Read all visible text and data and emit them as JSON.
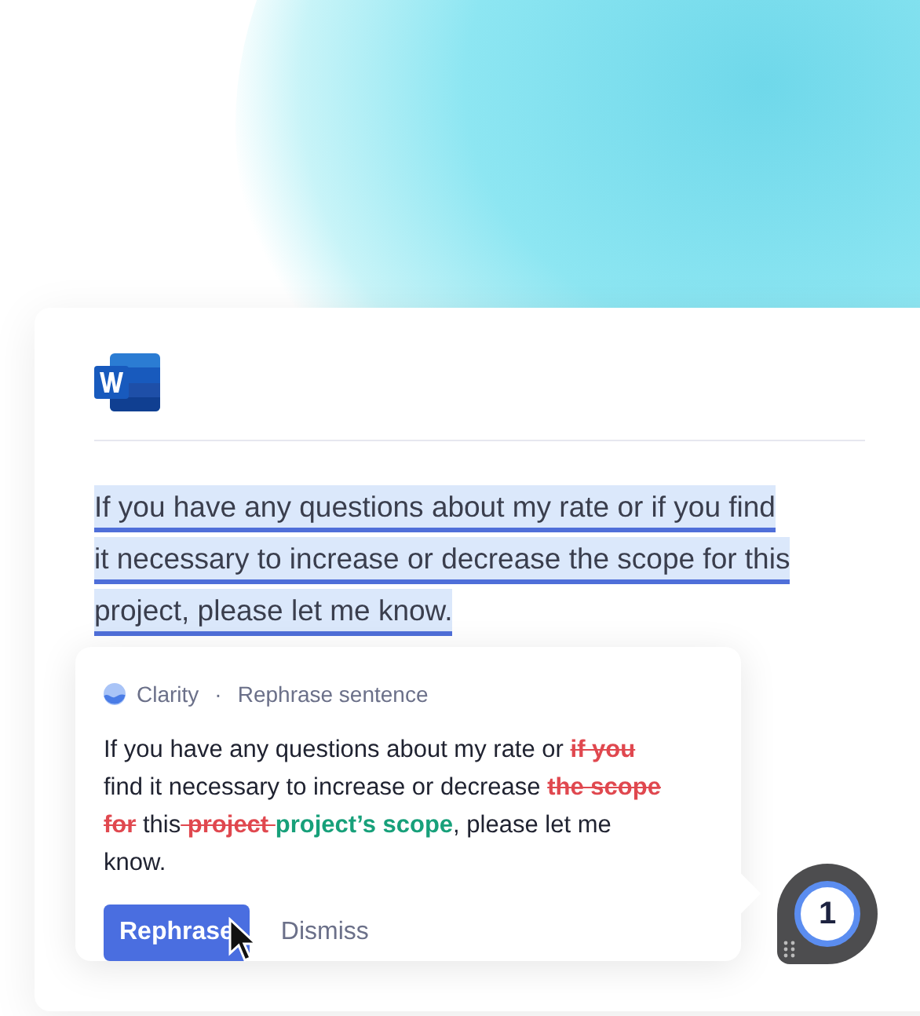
{
  "document": {
    "paragraph_lines": [
      "If you have any questions about my rate or if you find",
      "it necessary to increase or decrease the scope for this",
      "project, please let me know."
    ]
  },
  "suggestion": {
    "category": "Clarity",
    "separator": "·",
    "title": "Rephrase sentence",
    "segments": [
      {
        "kind": "plain",
        "text": "If you have any questions about my rate or "
      },
      {
        "kind": "deleted",
        "text": "if you"
      },
      {
        "kind": "plain",
        "text": " find it necessary to increase or decrease "
      },
      {
        "kind": "deleted",
        "text": "the scope for"
      },
      {
        "kind": "plain",
        "text": " this"
      },
      {
        "kind": "deleted",
        "text": " project "
      },
      {
        "kind": "inserted",
        "text": "project’s scope"
      },
      {
        "kind": "plain",
        "text": ", please let me know."
      }
    ],
    "buttons": [
      {
        "label": "Rephrase",
        "kind": "primary"
      },
      {
        "label": "Dismiss",
        "kind": "secondary"
      }
    ]
  },
  "badge": {
    "count": "1"
  }
}
